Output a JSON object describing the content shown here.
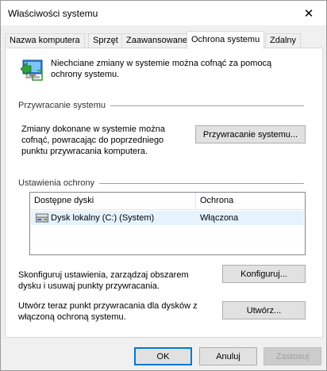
{
  "window": {
    "title": "Właściwości systemu",
    "close_glyph": "✕"
  },
  "tabs": [
    {
      "label": "Nazwa komputera",
      "active": false
    },
    {
      "label": "Sprzęt",
      "active": false
    },
    {
      "label": "Zaawansowane",
      "active": false
    },
    {
      "label": "Ochrona systemu",
      "active": true
    },
    {
      "label": "Zdalny",
      "active": false
    }
  ],
  "intro": {
    "icon": "system-protection-icon",
    "text": "Niechciane zmiany w systemie można cofnąć za pomocą ochrony systemu."
  },
  "restore_section": {
    "label": "Przywracanie systemu",
    "description": "Zmiany dokonane w systemie można cofnąć, powracając do poprzedniego punktu przywracania komputera.",
    "button": "Przywracanie systemu..."
  },
  "protection_section": {
    "label": "Ustawienia ochrony",
    "columns": [
      "Dostępne dyski",
      "Ochrona"
    ],
    "rows": [
      {
        "drive": "Dysk lokalny (C:) (System)",
        "protection": "Włączona",
        "icon": "local-disk-icon"
      }
    ],
    "configure_text": "Skonfiguruj ustawienia, zarządzaj obszarem dysku i usuwaj punkty przywracania.",
    "configure_button": "Konfiguruj...",
    "create_text": "Utwórz teraz punkt przywracania dla dysków z włączoną ochroną systemu.",
    "create_button": "Utwórz..."
  },
  "footer": {
    "ok": "OK",
    "cancel": "Anuluj",
    "apply": "Zastosuj"
  }
}
